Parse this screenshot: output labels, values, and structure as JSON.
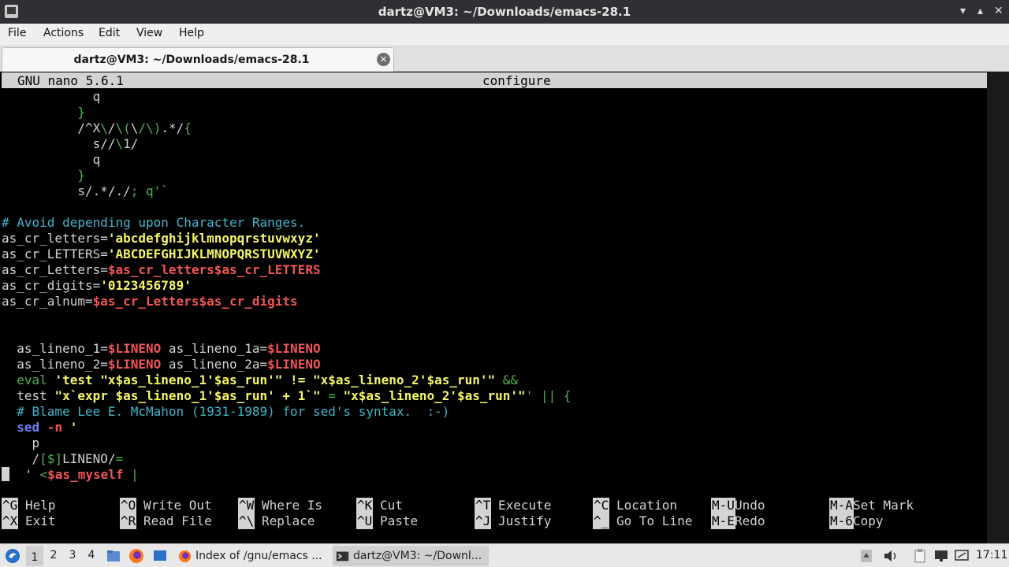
{
  "window": {
    "title": "dartz@VM3: ~/Downloads/emacs-28.1",
    "minimize_glyph": "▾",
    "maximize_glyph": "▴",
    "close_glyph": "✕"
  },
  "menubar": {
    "items": [
      "File",
      "Actions",
      "Edit",
      "View",
      "Help"
    ]
  },
  "tab": {
    "label": "dartz@VM3: ~/Downloads/emacs-28.1",
    "close_glyph": "✕"
  },
  "nano": {
    "version": "GNU nano 5.6.1",
    "filename": "configure",
    "lines": [
      [
        [
          "n",
          "            q"
        ]
      ],
      [
        [
          "g",
          "          }"
        ]
      ],
      [
        [
          "n",
          "          /^X"
        ],
        [
          "g",
          "\\"
        ],
        [
          "n",
          "/"
        ],
        [
          "g",
          "\\("
        ],
        [
          "n",
          "\\"
        ],
        [
          "g",
          "/\\)"
        ],
        [
          "n",
          ".*/"
        ],
        [
          "g",
          "{"
        ]
      ],
      [
        [
          "n",
          "            s//"
        ],
        [
          "g",
          "\\"
        ],
        [
          "n",
          "1/"
        ]
      ],
      [
        [
          "n",
          "            q"
        ]
      ],
      [
        [
          "g",
          "          }"
        ]
      ],
      [
        [
          "n",
          "          s/.*/./"
        ],
        [
          "g",
          "; q'`"
        ]
      ],
      [
        [
          "n",
          ""
        ]
      ],
      [
        [
          "c",
          "# Avoid depending upon Character Ranges."
        ]
      ],
      [
        [
          "n",
          "as_cr_letters="
        ],
        [
          "y",
          "'abcdefghijklmnopqrstuvwxyz'"
        ]
      ],
      [
        [
          "n",
          "as_cr_LETTERS="
        ],
        [
          "y",
          "'ABCDEFGHIJKLMNOPQRSTUVWXYZ'"
        ]
      ],
      [
        [
          "n",
          "as_cr_Letters="
        ],
        [
          "r",
          "$as_cr_letters$as_cr_LETTERS"
        ]
      ],
      [
        [
          "n",
          "as_cr_digits="
        ],
        [
          "y",
          "'0123456789'"
        ]
      ],
      [
        [
          "n",
          "as_cr_alnum="
        ],
        [
          "r",
          "$as_cr_Letters$as_cr_digits"
        ]
      ],
      [
        [
          "n",
          ""
        ]
      ],
      [
        [
          "n",
          ""
        ]
      ],
      [
        [
          "n",
          "  as_lineno_1="
        ],
        [
          "r",
          "$LINENO"
        ],
        [
          "n",
          " as_lineno_1a="
        ],
        [
          "r",
          "$LINENO"
        ]
      ],
      [
        [
          "n",
          "  as_lineno_2="
        ],
        [
          "r",
          "$LINENO"
        ],
        [
          "n",
          " as_lineno_2a="
        ],
        [
          "r",
          "$LINENO"
        ]
      ],
      [
        [
          "g",
          "  eval "
        ],
        [
          "y",
          "'test \"x$as_lineno_1'$as_run'\" != \"x$as_lineno_2'$as_run'\""
        ],
        [
          "g",
          " &&"
        ]
      ],
      [
        [
          "n",
          "  test "
        ],
        [
          "y",
          "\"x`expr $as_lineno_1'$as_run' + 1`\""
        ],
        [
          "g",
          " = "
        ],
        [
          "y",
          "\"x$as_lineno_2'$as_run'\""
        ],
        [
          "g",
          "' || {"
        ]
      ],
      [
        [
          "c",
          "  # Blame Lee E. McMahon (1931-1989) for sed's syntax.  :-)"
        ]
      ],
      [
        [
          "b",
          "  sed"
        ],
        [
          "r",
          " -n"
        ],
        [
          "y",
          " '"
        ]
      ],
      [
        [
          "n",
          "    p"
        ]
      ],
      [
        [
          "n",
          "    /"
        ],
        [
          "g",
          "[$]"
        ],
        [
          "n",
          "LINENO/"
        ],
        [
          "g",
          "="
        ]
      ],
      [
        [
          "n",
          "  ' "
        ],
        [
          "g",
          "<"
        ],
        [
          "r",
          "$as_myself"
        ],
        [
          "g",
          " |"
        ]
      ]
    ],
    "shortcuts": [
      [
        {
          "key": "^G",
          "label": "Help"
        },
        {
          "key": "^X",
          "label": "Exit"
        }
      ],
      [
        {
          "key": "^O",
          "label": "Write Out"
        },
        {
          "key": "^R",
          "label": "Read File"
        }
      ],
      [
        {
          "key": "^W",
          "label": "Where Is"
        },
        {
          "key": "^\\",
          "label": "Replace"
        }
      ],
      [
        {
          "key": "^K",
          "label": "Cut"
        },
        {
          "key": "^U",
          "label": "Paste"
        }
      ],
      [
        {
          "key": "^T",
          "label": "Execute"
        },
        {
          "key": "^J",
          "label": "Justify"
        }
      ],
      [
        {
          "key": "^C",
          "label": "Location"
        },
        {
          "key": "^_",
          "label": "Go To Line"
        }
      ],
      [
        {
          "key": "M-U",
          "label": "Undo"
        },
        {
          "key": "M-E",
          "label": "Redo"
        }
      ],
      [
        {
          "key": "M-A",
          "label": "Set Mark"
        },
        {
          "key": "M-6",
          "label": "Copy"
        }
      ]
    ]
  },
  "taskbar": {
    "workspaces": [
      "1",
      "2",
      "3",
      "4"
    ],
    "active_workspace": "1",
    "tasks": [
      {
        "label": "Index of /gnu/emacs ...",
        "icon": "firefox-icon"
      },
      {
        "label": "dartz@VM3: ~/Downl...",
        "icon": "terminal-icon"
      }
    ],
    "clock": "17:11"
  },
  "colors": {
    "terminal_bg": "#000000",
    "green": "#4eb34e",
    "yellow": "#f5f56a",
    "red": "#f05555",
    "cyan": "#3fb5c8",
    "blue": "#6e7ff5"
  }
}
